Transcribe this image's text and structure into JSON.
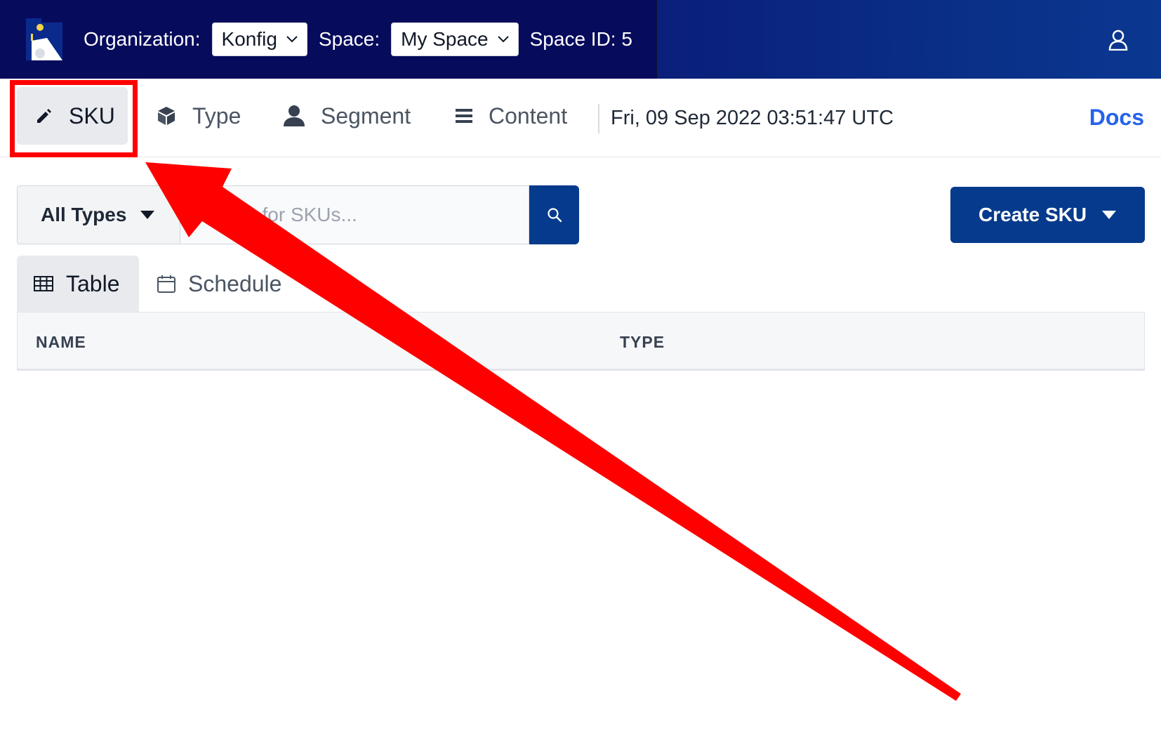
{
  "header": {
    "organization_label": "Organization:",
    "organization_value": "Konfig",
    "space_label": "Space:",
    "space_value": "My Space",
    "space_id": "Space ID: 5"
  },
  "nav": {
    "items": [
      {
        "label": "SKU",
        "icon": "pencil-icon",
        "active": true
      },
      {
        "label": "Type",
        "icon": "cube-icon"
      },
      {
        "label": "Segment",
        "icon": "person-icon"
      },
      {
        "label": "Content",
        "icon": "list-icon"
      }
    ],
    "timestamp": "Fri, 09 Sep 2022 03:51:47 UTC",
    "docs": "Docs"
  },
  "toolbar": {
    "type_filter": "All Types",
    "search_placeholder": "Search for SKUs...",
    "search_value": "",
    "create_label": "Create SKU"
  },
  "views": {
    "tabs": [
      {
        "label": "Table",
        "icon": "table-grid-icon",
        "active": true
      },
      {
        "label": "Schedule",
        "icon": "calendar-icon"
      }
    ]
  },
  "table": {
    "columns": [
      "NAME",
      "TYPE"
    ]
  },
  "colors": {
    "header_bg": "#070b5c",
    "primary": "#063a8c",
    "link": "#2563eb",
    "annotation": "#ff0000"
  }
}
